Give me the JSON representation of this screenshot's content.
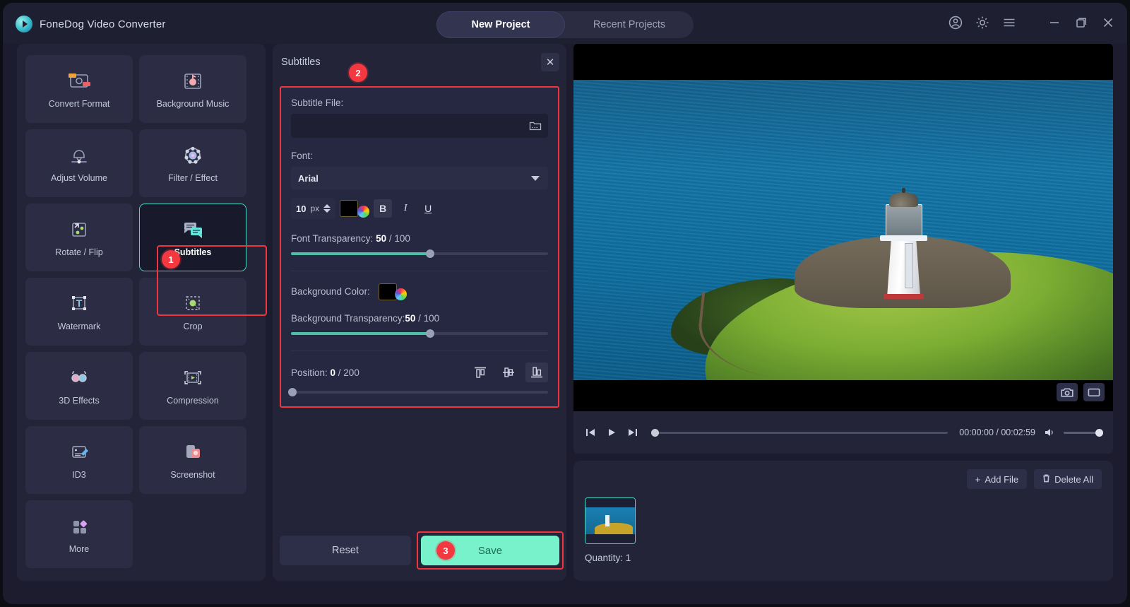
{
  "app": {
    "brand": "FoneDog Video Converter",
    "logo_icon": "play-circle-icon"
  },
  "titlebar": {
    "tabs": [
      {
        "label": "New Project",
        "active": true
      },
      {
        "label": "Recent Projects",
        "active": false
      }
    ],
    "icons": [
      {
        "name": "account-icon"
      },
      {
        "name": "gear-icon"
      },
      {
        "name": "menu-icon"
      },
      {
        "name": "minimize-icon"
      },
      {
        "name": "maximize-icon"
      },
      {
        "name": "close-icon"
      }
    ]
  },
  "tools": [
    {
      "label": "Convert Format",
      "icon": "convert-format-icon",
      "selected": false
    },
    {
      "label": "Background Music",
      "icon": "background-music-icon",
      "selected": false
    },
    {
      "label": "Adjust Volume",
      "icon": "adjust-volume-icon",
      "selected": false
    },
    {
      "label": "Filter / Effect",
      "icon": "filter-effect-icon",
      "selected": false
    },
    {
      "label": "Rotate / Flip",
      "icon": "rotate-flip-icon",
      "selected": false
    },
    {
      "label": "Subtitles",
      "icon": "subtitles-icon",
      "selected": true
    },
    {
      "label": "Watermark",
      "icon": "watermark-icon",
      "selected": false
    },
    {
      "label": "Crop",
      "icon": "crop-icon",
      "selected": false
    },
    {
      "label": "3D Effects",
      "icon": "3d-effects-icon",
      "selected": false
    },
    {
      "label": "Compression",
      "icon": "compression-icon",
      "selected": false
    },
    {
      "label": "ID3",
      "icon": "id3-icon",
      "selected": false
    },
    {
      "label": "Screenshot",
      "icon": "screenshot-icon",
      "selected": false
    },
    {
      "label": "More",
      "icon": "more-icon",
      "selected": false
    }
  ],
  "annotations": {
    "step1": "1",
    "step2": "2",
    "step3": "3",
    "highlight_color": "#f2353c"
  },
  "subtitles_panel": {
    "title": "Subtitles",
    "close_label": "✕",
    "subtitle_file": {
      "label": "Subtitle File:",
      "value": "",
      "placeholder": "",
      "browse_icon": "folder-icon"
    },
    "font": {
      "label": "Font:",
      "value": "Arial"
    },
    "font_size": {
      "value": "10",
      "unit": "px"
    },
    "font_color": "#000000",
    "style_buttons": [
      {
        "name": "bold-button",
        "label": "B",
        "active": true
      },
      {
        "name": "italic-button",
        "label": "I",
        "active": false
      },
      {
        "name": "underline-button",
        "label": "U",
        "active": false
      }
    ],
    "font_transparency": {
      "label_prefix": "Font Transparency: ",
      "value": "50",
      "label_suffix": " / 100",
      "max": 100,
      "percent": 50
    },
    "background_color": {
      "label": "Background Color:",
      "value": "#000000"
    },
    "background_transparency": {
      "label_prefix": "Background Transparency:",
      "value": "50",
      "label_suffix": " / 100",
      "max": 100,
      "percent": 50
    },
    "position": {
      "label_prefix": "Position: ",
      "value": "0",
      "label_suffix": " / 200",
      "max": 200,
      "percent": 0
    },
    "align_buttons": [
      {
        "name": "align-top-button",
        "active": false
      },
      {
        "name": "align-middle-button",
        "active": false
      },
      {
        "name": "align-bottom-button",
        "active": true
      }
    ],
    "reset_label": "Reset",
    "save_label": "Save"
  },
  "preview": {
    "snapshot_icon": "camera-icon",
    "fullscreen_icon": "screen-icon",
    "controls": {
      "prev_icon": "skip-previous-icon",
      "play_icon": "play-icon",
      "next_icon": "skip-next-icon",
      "current_time": "00:00:00",
      "total_time": "00:02:59",
      "time_display": "00:00:00 / 00:02:59",
      "volume_icon": "volume-icon",
      "progress_percent": 0,
      "volume_percent": 100
    }
  },
  "file_list": {
    "add_file_label": "Add File",
    "add_file_icon": "plus-icon",
    "delete_all_label": "Delete All",
    "delete_all_icon": "trash-icon",
    "quantity_label": "Quantity: 1",
    "thumbnail_name": "video-thumbnail"
  }
}
